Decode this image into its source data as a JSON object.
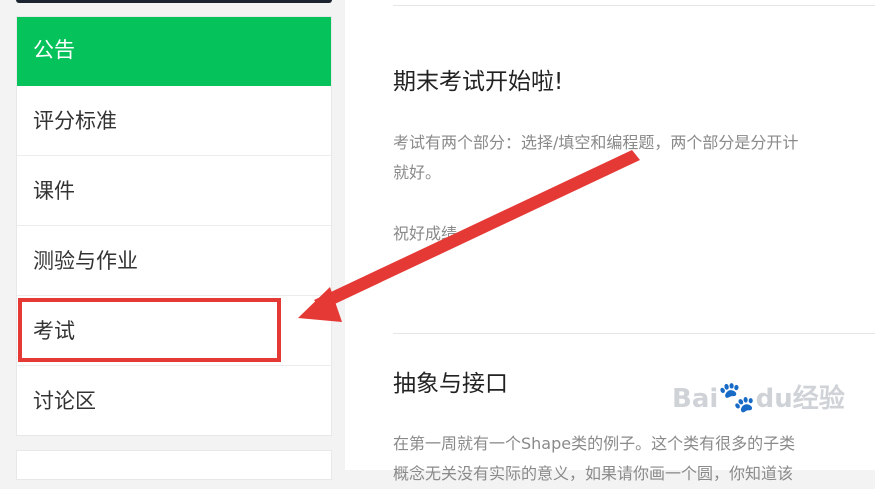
{
  "sidebar": {
    "items": [
      {
        "label": "公告",
        "active": true
      },
      {
        "label": "评分标准",
        "active": false
      },
      {
        "label": "课件",
        "active": false
      },
      {
        "label": "测验与作业",
        "active": false
      },
      {
        "label": "考试",
        "active": false
      },
      {
        "label": "讨论区",
        "active": false
      }
    ],
    "active_color": "#06c25a"
  },
  "posts": [
    {
      "title": "期末考试开始啦!",
      "line1": "考试有两个部分：选择/填空和编程题，两个部分是分开计",
      "line2": "就好。",
      "line3": "祝好成绩。"
    },
    {
      "title": "抽象与接口",
      "line1": "在第一周就有一个Shape类的例子。这个类有很多的子类",
      "line2": "概念无关没有实际的意义，如果请你画一个圆，你知道该"
    }
  ],
  "annotation": {
    "highlight_color": "#e53935",
    "arrow_color": "#e53935"
  },
  "watermark": {
    "text_a": "Bai",
    "text_b": "du",
    "text_c": "经验"
  }
}
